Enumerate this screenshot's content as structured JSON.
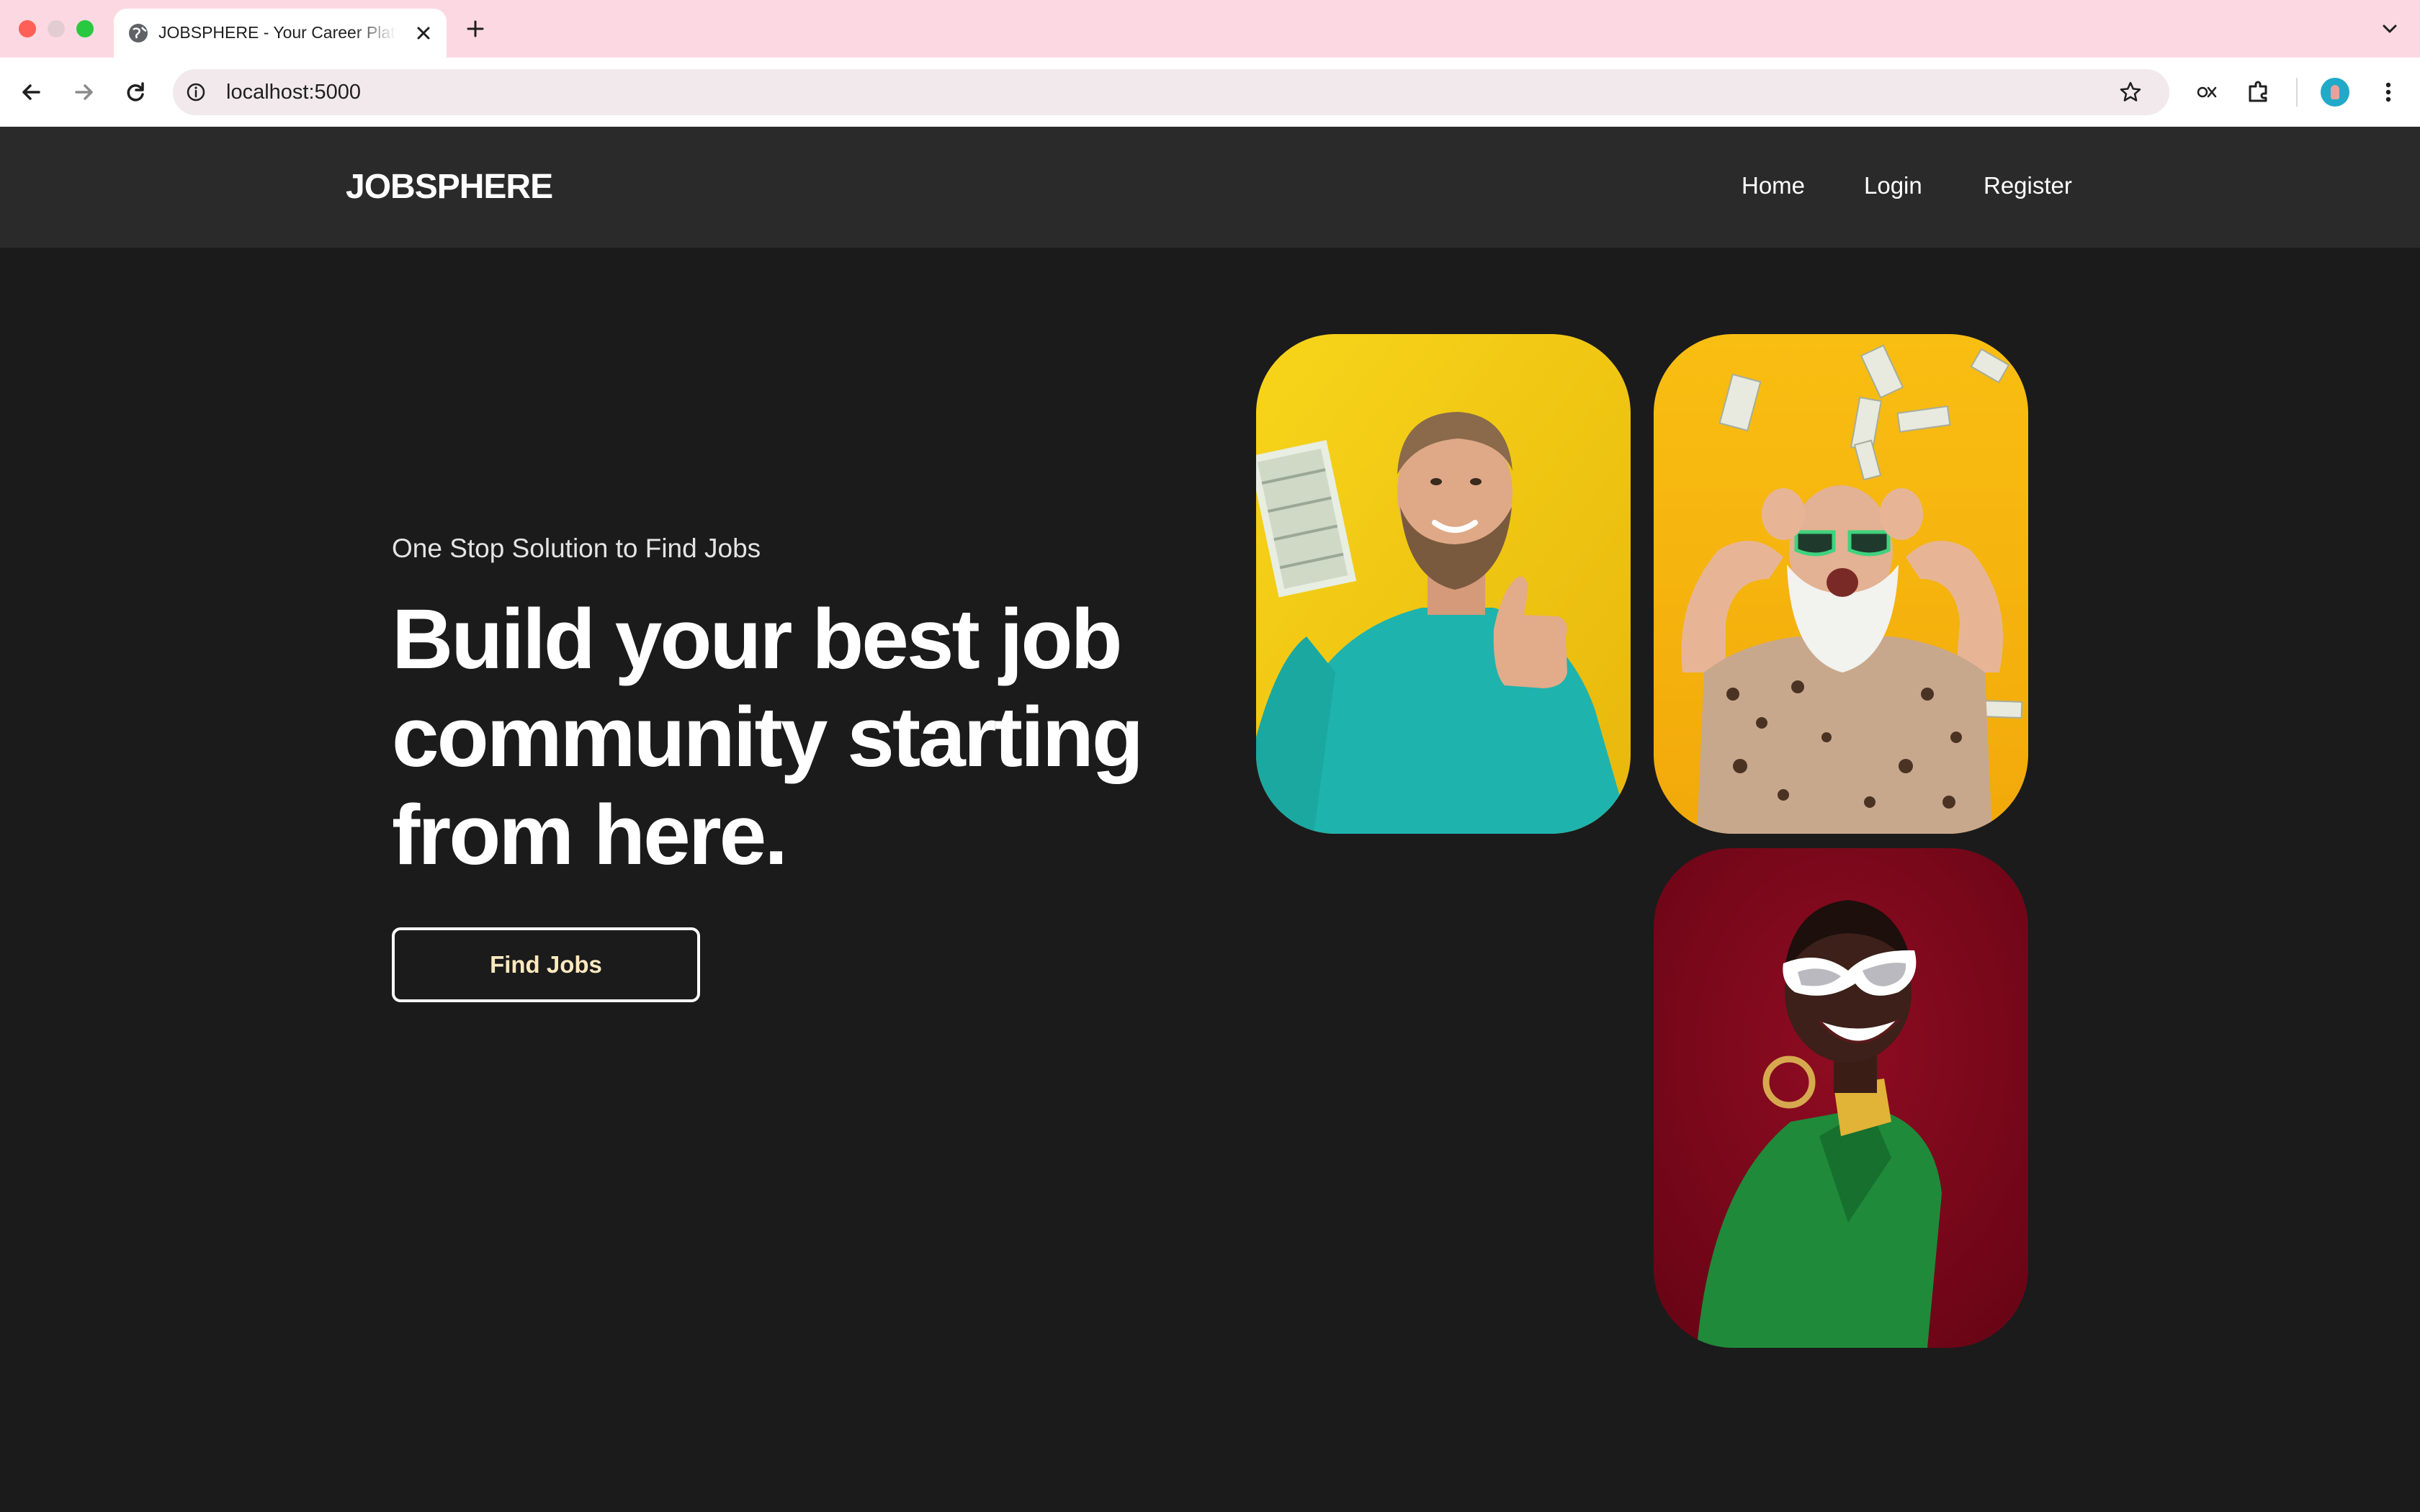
{
  "browser": {
    "tab_title": "JOBSPHERE - Your Career Platform",
    "url": "localhost:5000"
  },
  "site": {
    "logo": "JOBSPHERE",
    "nav": [
      {
        "label": "Home"
      },
      {
        "label": "Login"
      },
      {
        "label": "Register"
      }
    ]
  },
  "hero": {
    "subtitle": "One Stop Solution to Find Jobs",
    "title": "Build your best job community starting from here.",
    "cta_label": "Find Jobs"
  },
  "gallery": [
    {
      "subject": "bearded man in teal sweater holding cash, thumbs up",
      "background": "#f3cc12"
    },
    {
      "subject": "elderly man with sunglasses, money raining",
      "background": "#f7b40d"
    },
    {
      "subject": "smiling woman with white sunglasses and green jacket",
      "background": "#7c0619"
    }
  ],
  "colors": {
    "page_bg": "#1b1b1b",
    "header_bg": "#2a2a2a",
    "cta_text": "#ffe9bf",
    "tab_strip": "#fcd9e2"
  }
}
